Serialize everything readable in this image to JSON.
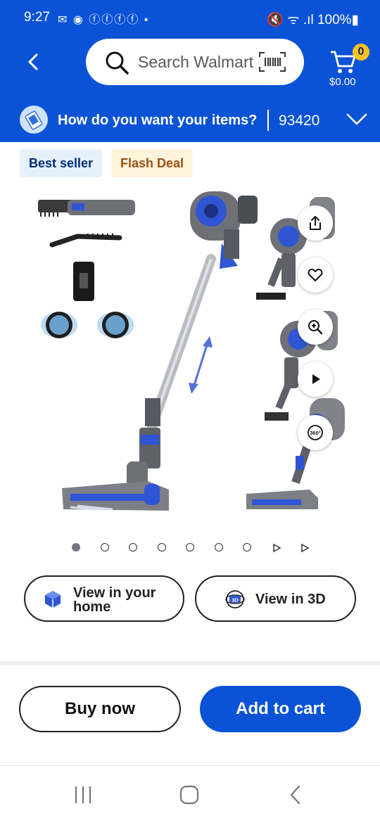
{
  "status_bar": {
    "time": "9:27",
    "notifications": "✉ ◉ ⓕⓕⓕⓕ •",
    "right": "🔇 ᯤ .ıl 100%▮"
  },
  "search": {
    "placeholder": "Search Walmart"
  },
  "cart": {
    "count": "0",
    "total": "$0.00"
  },
  "delivery": {
    "question": "How do you want your items?",
    "zip": "93420"
  },
  "tags": {
    "best_seller": "Best seller",
    "flash_deal": "Flash Deal"
  },
  "carousel": {
    "pages": 9,
    "current": 1
  },
  "view_buttons": {
    "home": "View in your home",
    "threed": "View in 3D",
    "threed_badge": "3D"
  },
  "actions": {
    "buy_now": "Buy now",
    "add_to_cart": "Add to cart"
  },
  "colors": {
    "brand_blue": "#0a53d6",
    "badge_yellow": "#ffc220",
    "vacuum_blue": "#2f55d4"
  },
  "icons": [
    "back-icon",
    "search-icon",
    "barcode-icon",
    "cart-icon",
    "chevron-down-icon",
    "share-icon",
    "heart-icon",
    "zoom-icon",
    "play-icon",
    "360-icon",
    "cube-icon",
    "3d-icon"
  ]
}
